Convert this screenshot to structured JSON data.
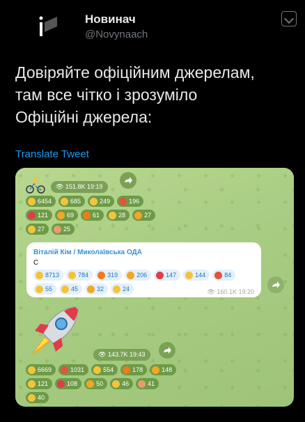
{
  "author": {
    "name": "Новинач",
    "handle": "@Novynaach"
  },
  "tweet": {
    "lines": [
      "Довіряйте офіційним джерелам,",
      "там все чітко і зрозуміло",
      "Офіційні джерела:"
    ],
    "translate_label": "Translate Tweet"
  },
  "media": {
    "post1": {
      "views": "151.8K",
      "time": "19:19",
      "reactions": [
        {
          "emoji": "thinking",
          "count": "6454",
          "color": "#f5c33b"
        },
        {
          "emoji": "thumbs-up",
          "count": "685",
          "color": "#f5c33b"
        },
        {
          "emoji": "grin",
          "count": "249",
          "color": "#f5c33b"
        },
        {
          "emoji": "angry",
          "count": "196",
          "color": "#e5533f"
        },
        {
          "emoji": "heart",
          "count": "121",
          "color": "#e23b4a"
        },
        {
          "emoji": "exploding-head",
          "count": "69",
          "color": "#f5a623"
        },
        {
          "emoji": "fire",
          "count": "61",
          "color": "#f27a1a"
        },
        {
          "emoji": "thumbs-down",
          "count": "28",
          "color": "#f5c33b"
        },
        {
          "emoji": "mind-blown",
          "count": "27",
          "color": "#f5a623"
        },
        {
          "emoji": "laugh",
          "count": "27",
          "color": "#f5c33b"
        },
        {
          "emoji": "clown",
          "count": "25",
          "color": "#e89b6f"
        }
      ]
    },
    "post2": {
      "author": "Віталій Кім / Миколаївська ОДА",
      "text": "С",
      "views": "160.1K",
      "time": "19:20",
      "reactions": [
        {
          "emoji": "thinking",
          "count": "8713",
          "color": "#f5c33b"
        },
        {
          "emoji": "thumbs-up",
          "count": "784",
          "color": "#f5c33b"
        },
        {
          "emoji": "fire",
          "count": "319",
          "color": "#f27a1a"
        },
        {
          "emoji": "exploding-head",
          "count": "206",
          "color": "#f5a623"
        },
        {
          "emoji": "heart",
          "count": "147",
          "color": "#e23b4a"
        },
        {
          "emoji": "grin",
          "count": "144",
          "color": "#f5c33b"
        },
        {
          "emoji": "angry",
          "count": "84",
          "color": "#e5533f"
        },
        {
          "emoji": "thumbs-down",
          "count": "55",
          "color": "#f5c33b"
        },
        {
          "emoji": "clap",
          "count": "45",
          "color": "#f5c33b"
        },
        {
          "emoji": "mind-blown",
          "count": "32",
          "color": "#f5a623"
        },
        {
          "emoji": "cry",
          "count": "24",
          "color": "#f5c33b"
        }
      ]
    },
    "post3": {
      "views": "143.7K",
      "time": "19:43",
      "reactions": [
        {
          "emoji": "thinking",
          "count": "6669",
          "color": "#f5c33b"
        },
        {
          "emoji": "angry",
          "count": "1031",
          "color": "#e5533f"
        },
        {
          "emoji": "thumbs-up",
          "count": "554",
          "color": "#f5c33b"
        },
        {
          "emoji": "fire",
          "count": "178",
          "color": "#f27a1a"
        },
        {
          "emoji": "exploding-head",
          "count": "148",
          "color": "#f5a623"
        },
        {
          "emoji": "scream",
          "count": "121",
          "color": "#f5c33b"
        },
        {
          "emoji": "heart",
          "count": "108",
          "color": "#e23b4a"
        },
        {
          "emoji": "mind-blown",
          "count": "50",
          "color": "#f5a623"
        },
        {
          "emoji": "thumbs-down",
          "count": "46",
          "color": "#f5c33b"
        },
        {
          "emoji": "clown",
          "count": "41",
          "color": "#e89b6f"
        },
        {
          "emoji": "clap",
          "count": "40",
          "color": "#f5c33b"
        }
      ]
    }
  }
}
